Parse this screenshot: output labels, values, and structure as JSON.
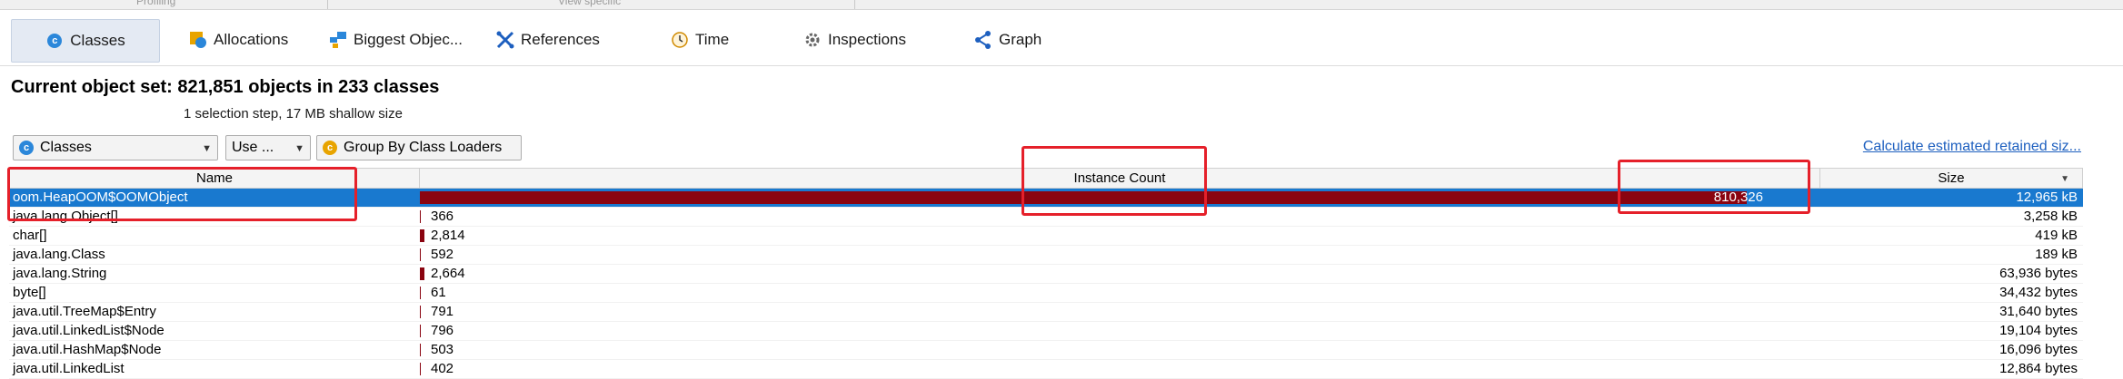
{
  "top_strip": {
    "left_label": "Profiling",
    "right_label": "View specific"
  },
  "tabs": [
    {
      "label": "Classes",
      "icon": "classes-icon",
      "active": true
    },
    {
      "label": "Allocations",
      "icon": "allocations-icon"
    },
    {
      "label": "Biggest Objec...",
      "icon": "biggest-objects-icon"
    },
    {
      "label": "References",
      "icon": "references-icon"
    },
    {
      "label": "Time",
      "icon": "time-icon"
    },
    {
      "label": "Inspections",
      "icon": "inspections-icon"
    },
    {
      "label": "Graph",
      "icon": "graph-icon"
    }
  ],
  "header": {
    "title": "Current object set:  821,851 objects in 233 classes",
    "subtitle": "1 selection step, 17 MB shallow size"
  },
  "toolbar": {
    "view_select": "Classes",
    "more_button": "Use ...",
    "group_button": "Group By Class Loaders",
    "retained_link": "Calculate estimated retained siz..."
  },
  "table": {
    "columns": [
      "Name",
      "Instance Count",
      "Size"
    ],
    "rows": [
      {
        "name": "oom.HeapOOM$OOMObject",
        "count": "810,326",
        "count_fraction": 1.0,
        "size": "12,965 kB",
        "selected": true
      },
      {
        "name": "java.lang.Object[]",
        "count": "366",
        "count_fraction": 0.0005,
        "size": "3,258 kB"
      },
      {
        "name": "char[]",
        "count": "2,814",
        "count_fraction": 0.0035,
        "size": "419 kB"
      },
      {
        "name": "java.lang.Class",
        "count": "592",
        "count_fraction": 0.0007,
        "size": "189 kB"
      },
      {
        "name": "java.lang.String",
        "count": "2,664",
        "count_fraction": 0.0033,
        "size": "63,936 bytes"
      },
      {
        "name": "byte[]",
        "count": "61",
        "count_fraction": 0.0001,
        "size": "34,432 bytes"
      },
      {
        "name": "java.util.TreeMap$Entry",
        "count": "791",
        "count_fraction": 0.001,
        "size": "31,640 bytes"
      },
      {
        "name": "java.util.LinkedList$Node",
        "count": "796",
        "count_fraction": 0.001,
        "size": "19,104 bytes"
      },
      {
        "name": "java.util.HashMap$Node",
        "count": "503",
        "count_fraction": 0.0006,
        "size": "16,096 bytes"
      },
      {
        "name": "java.util.LinkedList",
        "count": "402",
        "count_fraction": 0.0005,
        "size": "12,864 bytes"
      }
    ]
  },
  "colors": {
    "selection": "#1979cf",
    "bar": "#8a0410",
    "highlight": "#e5202a",
    "link": "#1d5fbf"
  }
}
